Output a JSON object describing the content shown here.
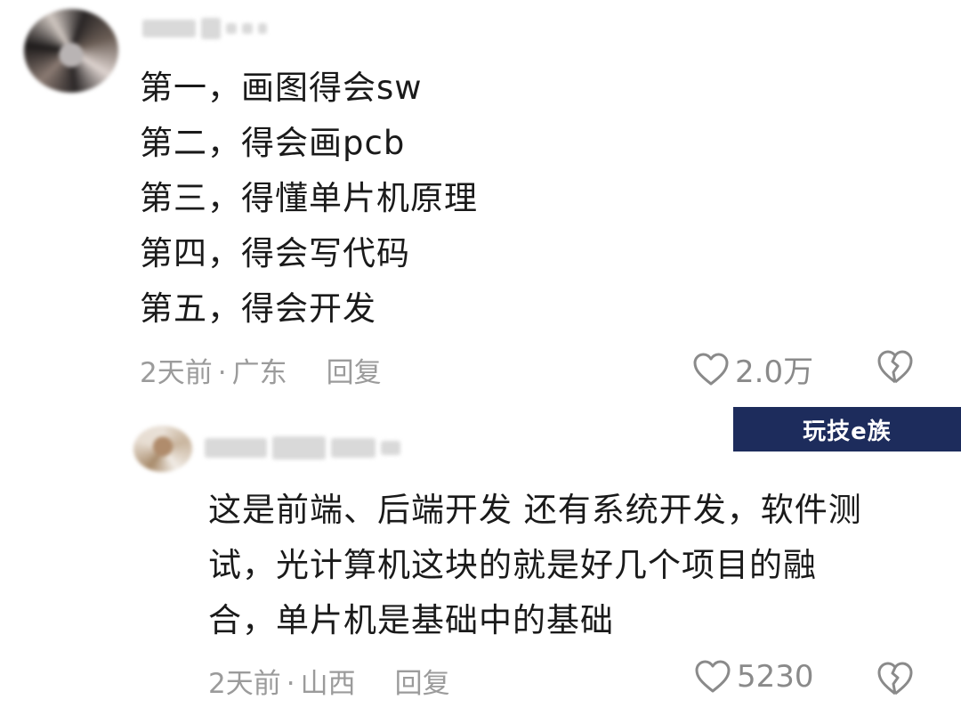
{
  "comments": [
    {
      "lines": [
        "第一，画图得会sw",
        "第二，得会画pcb",
        "第三，得懂单片机原理",
        "第四，得会写代码",
        "第五，得会开发"
      ],
      "time": "2天前",
      "location": "广东",
      "reply_label": "回复",
      "likes": "2.0万"
    },
    {
      "lines": [
        "这是前端、后端开发 还有系统开发，软件测",
        "试，光计算机这块的就是好几个项目的融",
        "合，单片机是基础中的基础"
      ],
      "time": "2天前",
      "location": "山西",
      "reply_label": "回复",
      "likes": "5230"
    }
  ],
  "watermark": "玩技e族",
  "colors": {
    "meta": "#9b9b9b",
    "badge_bg": "#1d2c5c"
  }
}
